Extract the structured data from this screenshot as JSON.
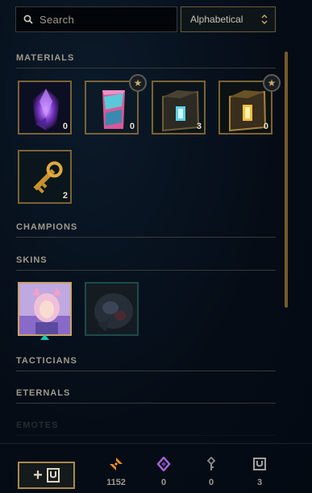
{
  "search": {
    "placeholder": "Search",
    "value": ""
  },
  "sort": {
    "selected": "Alphabetical"
  },
  "sections": {
    "materials": {
      "title": "MATERIALS",
      "items": [
        {
          "name": "gemstone",
          "count": "0",
          "starred": false
        },
        {
          "name": "chroma-fragment",
          "count": "0",
          "starred": true
        },
        {
          "name": "hextech-chest",
          "count": "3",
          "starred": false
        },
        {
          "name": "masterwork-chest",
          "count": "0",
          "starred": true
        },
        {
          "name": "hextech-key",
          "count": "2",
          "starred": false
        }
      ]
    },
    "champions": {
      "title": "CHAMPIONS"
    },
    "skins": {
      "title": "SKINS",
      "items": [
        {
          "name": "skin-shard-pink"
        },
        {
          "name": "skin-shard-dark"
        }
      ]
    },
    "tacticians": {
      "title": "TACTICIANS"
    },
    "eternals": {
      "title": "ETERNALS"
    },
    "emotes": {
      "title": "EMOTES"
    }
  },
  "bottom": {
    "add_button": {
      "plus": "+",
      "icon": "chest-icon"
    },
    "currencies": [
      {
        "icon": "blue-essence-icon",
        "value": "1152",
        "color": "#f08c24"
      },
      {
        "icon": "mythic-essence-icon",
        "value": "0",
        "color": "#a865d8"
      },
      {
        "icon": "key-fragment-icon",
        "value": "0",
        "color": "#8c8c8c"
      },
      {
        "icon": "chest-icon",
        "value": "3",
        "color": "#a0a0a0"
      }
    ]
  }
}
